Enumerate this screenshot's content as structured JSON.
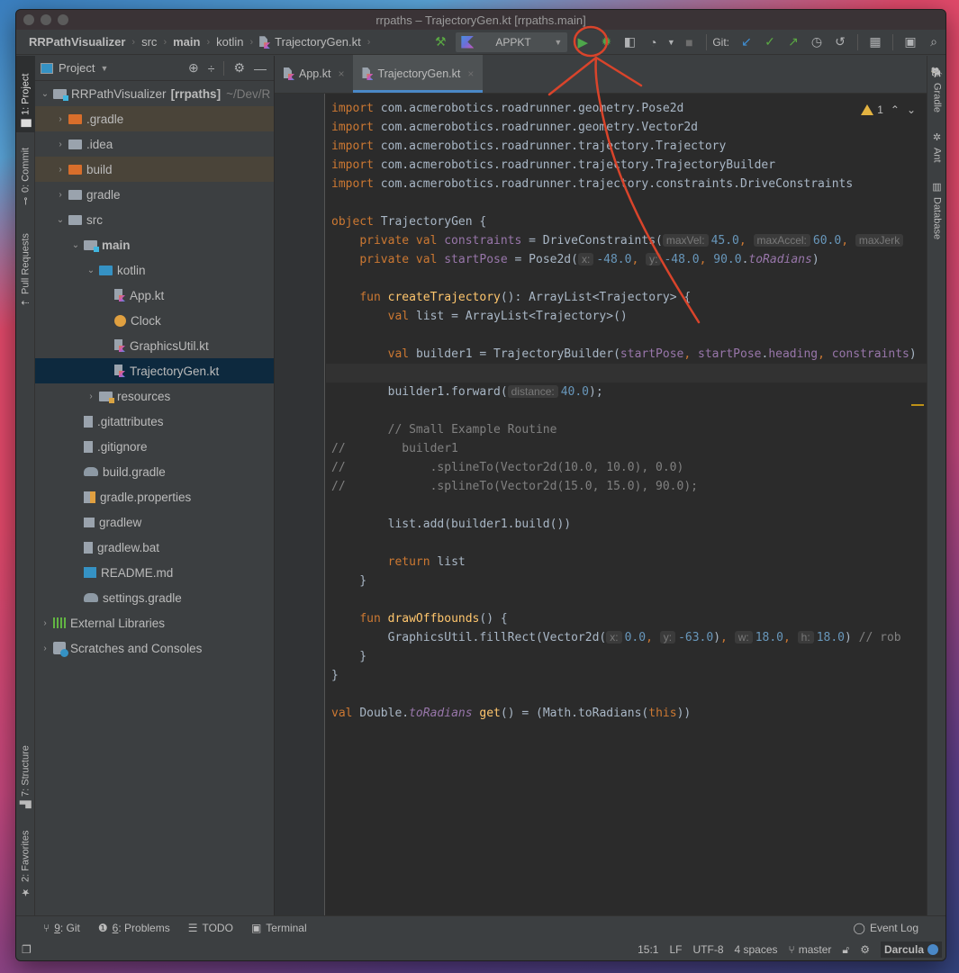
{
  "window": {
    "title": "rrpaths – TrajectoryGen.kt [rrpaths.main]"
  },
  "breadcrumb": [
    {
      "label": "RRPathVisualizer",
      "bold": true
    },
    {
      "label": "src",
      "bold": false
    },
    {
      "label": "main",
      "bold": true
    },
    {
      "label": "kotlin",
      "bold": false
    },
    {
      "label": "TrajectoryGen.kt",
      "bold": false
    }
  ],
  "toolbar": {
    "build_icon": "hammer-icon",
    "run_config": "APPKT",
    "run_icon": "run-icon",
    "debug_icon": "debug-icon",
    "coverage_icon": "coverage-icon",
    "profile_icon": "profile-icon",
    "stop_icon": "stop-icon",
    "git_label": "Git:",
    "git_update_icon": "git-update-icon",
    "git_commit_icon": "git-commit-icon",
    "git_push_icon": "git-push-icon",
    "history_icon": "history-icon",
    "rollback_icon": "rollback-icon",
    "project_structure_icon": "project-structure-icon",
    "presentation_icon": "presentation-icon",
    "search_icon": "search-icon"
  },
  "left_strip": {
    "project": "1: Project",
    "commit": "0: Commit",
    "pull_requests": "Pull Requests",
    "structure": "7: Structure",
    "favorites": "2: Favorites"
  },
  "right_strip": {
    "gradle": "Gradle",
    "ant": "Ant",
    "database": "Database"
  },
  "project_panel": {
    "title": "Project",
    "root": {
      "name": "RRPathVisualizer",
      "module": "[rrpaths]",
      "path": "~/Dev/R"
    },
    "items": [
      {
        "label": ".gradle",
        "depth": 1,
        "arrow": "right",
        "icon": "folder-orange",
        "ignored": true
      },
      {
        "label": ".idea",
        "depth": 1,
        "arrow": "right",
        "icon": "folder-grey"
      },
      {
        "label": "build",
        "depth": 1,
        "arrow": "right",
        "icon": "folder-orange",
        "ignored": true
      },
      {
        "label": "gradle",
        "depth": 1,
        "arrow": "right",
        "icon": "folder-grey"
      },
      {
        "label": "src",
        "depth": 1,
        "arrow": "down",
        "icon": "folder-grey"
      },
      {
        "label": "main",
        "depth": 2,
        "arrow": "down",
        "icon": "folder-module",
        "bold": true
      },
      {
        "label": "kotlin",
        "depth": 3,
        "arrow": "down",
        "icon": "folder-blue"
      },
      {
        "label": "App.kt",
        "depth": 4,
        "arrow": "none",
        "icon": "kotlin-file"
      },
      {
        "label": "Clock",
        "depth": 4,
        "arrow": "none",
        "icon": "kotlin-class"
      },
      {
        "label": "GraphicsUtil.kt",
        "depth": 4,
        "arrow": "none",
        "icon": "kotlin-file"
      },
      {
        "label": "TrajectoryGen.kt",
        "depth": 4,
        "arrow": "none",
        "icon": "kotlin-file",
        "selected": true
      },
      {
        "label": "resources",
        "depth": 3,
        "arrow": "right",
        "icon": "folder-resources"
      },
      {
        "label": ".gitattributes",
        "depth": 2,
        "arrow": "none",
        "icon": "text-file"
      },
      {
        "label": ".gitignore",
        "depth": 2,
        "arrow": "none",
        "icon": "text-file"
      },
      {
        "label": "build.gradle",
        "depth": 2,
        "arrow": "none",
        "icon": "gradle-file"
      },
      {
        "label": "gradle.properties",
        "depth": 2,
        "arrow": "none",
        "icon": "properties-file"
      },
      {
        "label": "gradlew",
        "depth": 2,
        "arrow": "none",
        "icon": "shell-file"
      },
      {
        "label": "gradlew.bat",
        "depth": 2,
        "arrow": "none",
        "icon": "text-file"
      },
      {
        "label": "README.md",
        "depth": 2,
        "arrow": "none",
        "icon": "markdown-file"
      },
      {
        "label": "settings.gradle",
        "depth": 2,
        "arrow": "none",
        "icon": "gradle-file"
      },
      {
        "label": "External Libraries",
        "depth": 0,
        "arrow": "right",
        "icon": "libraries"
      },
      {
        "label": "Scratches and Consoles",
        "depth": 0,
        "arrow": "right",
        "icon": "scratches"
      }
    ]
  },
  "editor": {
    "tabs": [
      {
        "label": "App.kt",
        "active": false
      },
      {
        "label": "TrajectoryGen.kt",
        "active": true
      }
    ],
    "warnings": {
      "count": "1"
    },
    "current_line": 15,
    "lines": [
      [
        [
          "kw",
          "import "
        ],
        [
          "t",
          "com.acmerobotics.roadrunner.geometry.Pose2d"
        ]
      ],
      [
        [
          "kw",
          "import "
        ],
        [
          "t",
          "com.acmerobotics.roadrunner.geometry.Vector2d"
        ]
      ],
      [
        [
          "kw",
          "import "
        ],
        [
          "t",
          "com.acmerobotics.roadrunner.trajectory.Trajectory"
        ]
      ],
      [
        [
          "kw",
          "import "
        ],
        [
          "t",
          "com.acmerobotics.roadrunner.trajectory.TrajectoryBuilder"
        ]
      ],
      [
        [
          "kw",
          "import "
        ],
        [
          "t",
          "com.acmerobotics.roadrunner.trajectory.constraints.DriveConstraints"
        ]
      ],
      [],
      [
        [
          "kw",
          "object "
        ],
        [
          "t",
          "TrajectoryGen {"
        ]
      ],
      [
        [
          "t",
          "    "
        ],
        [
          "kw",
          "private val "
        ],
        [
          "prop",
          "constraints"
        ],
        [
          "t",
          " = DriveConstraints("
        ],
        [
          "hint",
          "maxVel:"
        ],
        [
          "num",
          "45.0"
        ],
        [
          "kw",
          ", "
        ],
        [
          "hint",
          "maxAccel:"
        ],
        [
          "num",
          "60.0"
        ],
        [
          "kw",
          ", "
        ],
        [
          "hint",
          "maxJerk"
        ]
      ],
      [
        [
          "t",
          "    "
        ],
        [
          "kw",
          "private val "
        ],
        [
          "prop",
          "startPose"
        ],
        [
          "t",
          " = Pose2d("
        ],
        [
          "hint",
          "x:"
        ],
        [
          "num",
          "-48.0"
        ],
        [
          "kw",
          ", "
        ],
        [
          "hint",
          "y:"
        ],
        [
          "num",
          "-48.0"
        ],
        [
          "kw",
          ", "
        ],
        [
          "num",
          "90.0"
        ],
        [
          "t",
          "."
        ],
        [
          "ital",
          "toRadians"
        ],
        [
          "t",
          ")"
        ]
      ],
      [],
      [
        [
          "t",
          "    "
        ],
        [
          "kw",
          "fun "
        ],
        [
          "fn",
          "createTrajectory"
        ],
        [
          "t",
          "(): ArrayList<Trajectory> {"
        ]
      ],
      [
        [
          "t",
          "        "
        ],
        [
          "kw",
          "val "
        ],
        [
          "t",
          "list = ArrayList<Trajectory>()"
        ]
      ],
      [],
      [
        [
          "t",
          "        "
        ],
        [
          "kw",
          "val "
        ],
        [
          "t",
          "builder1 = TrajectoryBuilder("
        ],
        [
          "prop",
          "startPose"
        ],
        [
          "kw",
          ", "
        ],
        [
          "prop",
          "startPose"
        ],
        [
          "t",
          "."
        ],
        [
          "prop",
          "heading"
        ],
        [
          "kw",
          ", "
        ],
        [
          "prop",
          "constraints"
        ],
        [
          "t",
          ")"
        ]
      ],
      [],
      [
        [
          "t",
          "        builder1.forward("
        ],
        [
          "hint",
          "distance:"
        ],
        [
          "num",
          "40.0"
        ],
        [
          "t",
          ");"
        ]
      ],
      [],
      [
        [
          "t",
          "        "
        ],
        [
          "cmt",
          "// Small Example Routine"
        ]
      ],
      [
        [
          "cmt",
          "//        builder1"
        ]
      ],
      [
        [
          "cmt",
          "//            .splineTo(Vector2d(10.0, 10.0), 0.0)"
        ]
      ],
      [
        [
          "cmt",
          "//            .splineTo(Vector2d(15.0, 15.0), 90.0);"
        ]
      ],
      [],
      [
        [
          "t",
          "        list.add(builder1.build())"
        ]
      ],
      [],
      [
        [
          "t",
          "        "
        ],
        [
          "kw",
          "return "
        ],
        [
          "t",
          "list"
        ]
      ],
      [
        [
          "t",
          "    }"
        ]
      ],
      [],
      [
        [
          "t",
          "    "
        ],
        [
          "kw",
          "fun "
        ],
        [
          "fn",
          "drawOffbounds"
        ],
        [
          "t",
          "() {"
        ]
      ],
      [
        [
          "t",
          "        GraphicsUtil.fillRect(Vector2d("
        ],
        [
          "hint",
          "x:"
        ],
        [
          "num",
          "0.0"
        ],
        [
          "kw",
          ", "
        ],
        [
          "hint",
          "y:"
        ],
        [
          "num",
          "-63.0"
        ],
        [
          "t",
          ")"
        ],
        [
          "kw",
          ", "
        ],
        [
          "hint",
          "w:"
        ],
        [
          "num",
          "18.0"
        ],
        [
          "kw",
          ", "
        ],
        [
          "hint",
          "h:"
        ],
        [
          "num",
          "18.0"
        ],
        [
          "t",
          ") "
        ],
        [
          "cmt",
          "// rob"
        ]
      ],
      [
        [
          "t",
          "    }"
        ]
      ],
      [
        [
          "t",
          "}"
        ]
      ],
      [],
      [
        [
          "kw",
          "val "
        ],
        [
          "t",
          "Double."
        ],
        [
          "ital",
          "toRadians"
        ],
        [
          "t",
          " "
        ],
        [
          "fn",
          "get"
        ],
        [
          "t",
          "() = (Math.toRadians("
        ],
        [
          "kw",
          "this"
        ],
        [
          "t",
          "))"
        ]
      ],
      []
    ],
    "fold_lines": [
      1,
      5,
      7,
      11,
      26,
      28,
      30,
      31
    ]
  },
  "bottom_tools": [
    {
      "key": "9",
      "label": ": Git",
      "icon": "git-branch-icon"
    },
    {
      "key": "6",
      "label": ": Problems",
      "icon": "problems-icon"
    },
    {
      "key": "",
      "label": "TODO",
      "icon": "todo-icon"
    },
    {
      "key": "",
      "label": "Terminal",
      "icon": "terminal-icon"
    }
  ],
  "event_log": "Event Log",
  "status": {
    "position": "15:1",
    "line_sep": "LF",
    "encoding": "UTF-8",
    "indent": "4 spaces",
    "branch": "master",
    "theme": "Darcula"
  },
  "annotation": {
    "color": "#d9442b",
    "target": "run-button"
  }
}
